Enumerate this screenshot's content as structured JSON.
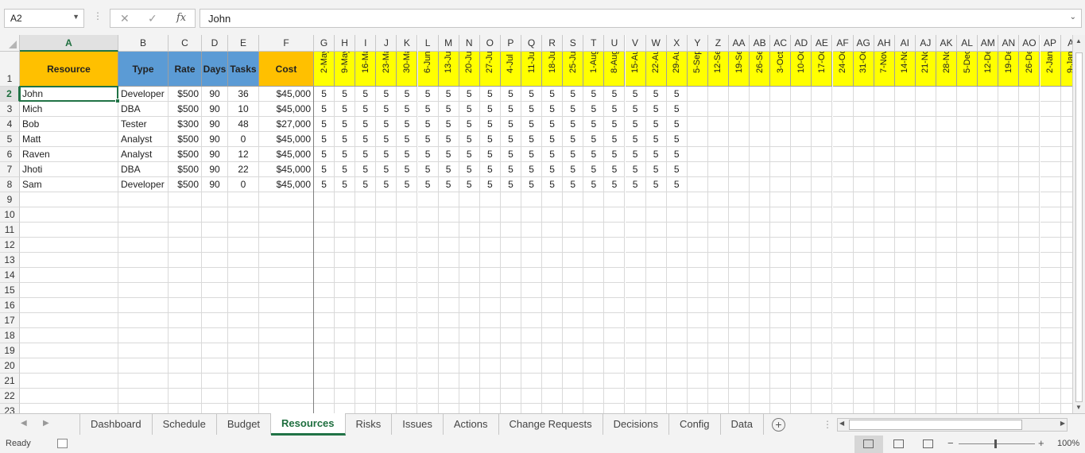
{
  "formula_bar": {
    "name_box": "A2",
    "cancel_icon": "✕",
    "enter_icon": "✓",
    "fx_label": "fx",
    "content": "John"
  },
  "grid": {
    "column_letters": [
      "A",
      "B",
      "C",
      "D",
      "E",
      "F",
      "G",
      "H",
      "I",
      "J",
      "K",
      "L",
      "M",
      "N",
      "O",
      "P",
      "Q",
      "R",
      "S",
      "T",
      "U",
      "V",
      "W",
      "X",
      "Y",
      "Z",
      "AA",
      "AB",
      "AC",
      "AD",
      "AE",
      "AF",
      "AG",
      "AH",
      "AI",
      "AJ",
      "AK",
      "AL",
      "AM",
      "AN",
      "AO",
      "AP",
      "A"
    ],
    "row_numbers": [
      "1",
      "2",
      "3",
      "4",
      "5",
      "6",
      "7",
      "8",
      "9",
      "10",
      "11",
      "12",
      "13",
      "14",
      "15",
      "16",
      "17",
      "18",
      "19",
      "20",
      "21",
      "22",
      "23"
    ],
    "selected_cell": "A2",
    "headers": [
      "Resource",
      "Type",
      "Rate",
      "Days",
      "Tasks",
      "Cost"
    ],
    "week_dates": [
      "2-May",
      "9-May",
      "16-May",
      "23-May",
      "30-May",
      "6-Jun",
      "13-Jun",
      "20-Jun",
      "27-Jun",
      "4-Jul",
      "11-Jul",
      "18-Jul",
      "25-Jul",
      "1-Aug",
      "8-Aug",
      "15-Aug",
      "22-Aug",
      "29-Aug",
      "5-Sep",
      "12-Sep",
      "19-Sep",
      "26-Sep",
      "3-Oct",
      "10-Oct",
      "17-Oct",
      "24-Oct",
      "31-Oct",
      "7-Nov",
      "14-Nov",
      "21-Nov",
      "28-Nov",
      "5-Dec",
      "12-Dec",
      "19-Dec",
      "26-Dec",
      "2-Jan",
      "9-Jan"
    ],
    "rows": [
      {
        "resource": "John",
        "type": "Developer",
        "rate": "$500",
        "days": "90",
        "tasks": "36",
        "cost": "$45,000",
        "weeks": [
          "5",
          "5",
          "5",
          "5",
          "5",
          "5",
          "5",
          "5",
          "5",
          "5",
          "5",
          "5",
          "5",
          "5",
          "5",
          "5",
          "5",
          "5"
        ]
      },
      {
        "resource": "Mich",
        "type": "DBA",
        "rate": "$500",
        "days": "90",
        "tasks": "10",
        "cost": "$45,000",
        "weeks": [
          "5",
          "5",
          "5",
          "5",
          "5",
          "5",
          "5",
          "5",
          "5",
          "5",
          "5",
          "5",
          "5",
          "5",
          "5",
          "5",
          "5",
          "5"
        ]
      },
      {
        "resource": "Bob",
        "type": "Tester",
        "rate": "$300",
        "days": "90",
        "tasks": "48",
        "cost": "$27,000",
        "weeks": [
          "5",
          "5",
          "5",
          "5",
          "5",
          "5",
          "5",
          "5",
          "5",
          "5",
          "5",
          "5",
          "5",
          "5",
          "5",
          "5",
          "5",
          "5"
        ]
      },
      {
        "resource": "Matt",
        "type": "Analyst",
        "rate": "$500",
        "days": "90",
        "tasks": "0",
        "cost": "$45,000",
        "weeks": [
          "5",
          "5",
          "5",
          "5",
          "5",
          "5",
          "5",
          "5",
          "5",
          "5",
          "5",
          "5",
          "5",
          "5",
          "5",
          "5",
          "5",
          "5"
        ]
      },
      {
        "resource": "Raven",
        "type": "Analyst",
        "rate": "$500",
        "days": "90",
        "tasks": "12",
        "cost": "$45,000",
        "weeks": [
          "5",
          "5",
          "5",
          "5",
          "5",
          "5",
          "5",
          "5",
          "5",
          "5",
          "5",
          "5",
          "5",
          "5",
          "5",
          "5",
          "5",
          "5"
        ]
      },
      {
        "resource": "Jhoti",
        "type": "DBA",
        "rate": "$500",
        "days": "90",
        "tasks": "22",
        "cost": "$45,000",
        "weeks": [
          "5",
          "5",
          "5",
          "5",
          "5",
          "5",
          "5",
          "5",
          "5",
          "5",
          "5",
          "5",
          "5",
          "5",
          "5",
          "5",
          "5",
          "5"
        ]
      },
      {
        "resource": "Sam",
        "type": "Developer",
        "rate": "$500",
        "days": "90",
        "tasks": "0",
        "cost": "$45,000",
        "weeks": [
          "5",
          "5",
          "5",
          "5",
          "5",
          "5",
          "5",
          "5",
          "5",
          "5",
          "5",
          "5",
          "5",
          "5",
          "5",
          "5",
          "5",
          "5"
        ]
      }
    ]
  },
  "colors": {
    "resource_header": "#ffc000",
    "cost_header": "#ffc000",
    "blue_header": "#5b9bd5",
    "week_header": "#ffff00",
    "excel_green": "#217346"
  },
  "sheet_tabs": {
    "tabs": [
      "Dashboard",
      "Schedule",
      "Budget",
      "Resources",
      "Risks",
      "Issues",
      "Actions",
      "Change Requests",
      "Decisions",
      "Config",
      "Data"
    ],
    "active": "Resources",
    "add_icon": "+"
  },
  "status_bar": {
    "ready": "Ready",
    "zoom": "100%"
  }
}
